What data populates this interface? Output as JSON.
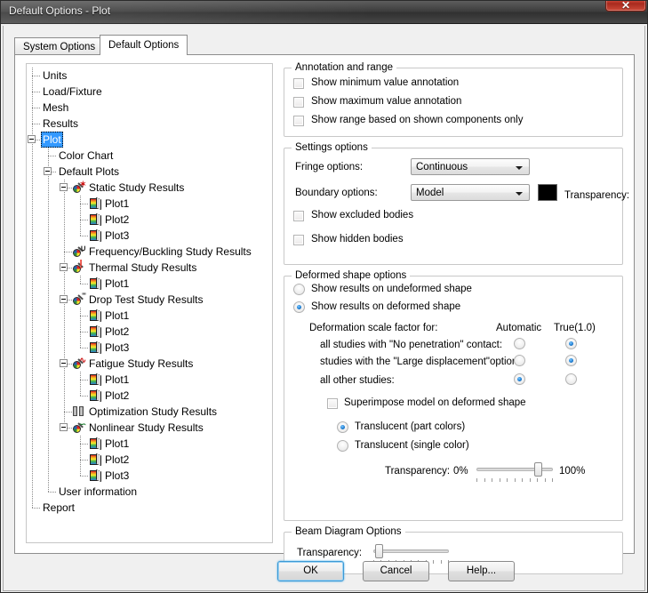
{
  "window": {
    "title": "Default Options - Plot",
    "close_label": "✕"
  },
  "tabs": [
    {
      "label": "System Options",
      "active": false
    },
    {
      "label": "Default Options",
      "active": true
    }
  ],
  "tree": {
    "nodes": [
      {
        "label": "Units",
        "depth": 0,
        "icon": "none",
        "expander": "none",
        "selected": false
      },
      {
        "label": "Load/Fixture",
        "depth": 0,
        "icon": "none",
        "expander": "none",
        "selected": false
      },
      {
        "label": "Mesh",
        "depth": 0,
        "icon": "none",
        "expander": "none",
        "selected": false
      },
      {
        "label": "Results",
        "depth": 0,
        "icon": "none",
        "expander": "none",
        "selected": false
      },
      {
        "label": "Plot",
        "depth": 0,
        "icon": "none",
        "expander": "minus",
        "selected": true
      },
      {
        "label": "Color Chart",
        "depth": 1,
        "icon": "none",
        "expander": "none",
        "selected": false
      },
      {
        "label": "Default Plots",
        "depth": 1,
        "icon": "none",
        "expander": "minus",
        "selected": false
      },
      {
        "label": "Static Study Results",
        "depth": 2,
        "icon": "study-static",
        "expander": "minus",
        "selected": false
      },
      {
        "label": "Plot1",
        "depth": 3,
        "icon": "plot",
        "expander": "none",
        "selected": false
      },
      {
        "label": "Plot2",
        "depth": 3,
        "icon": "plot",
        "expander": "none",
        "selected": false
      },
      {
        "label": "Plot3",
        "depth": 3,
        "icon": "plot",
        "expander": "none",
        "selected": false
      },
      {
        "label": "Frequency/Buckling Study Results",
        "depth": 2,
        "icon": "study-frequency",
        "expander": "none",
        "selected": false
      },
      {
        "label": "Thermal Study Results",
        "depth": 2,
        "icon": "study-thermal",
        "expander": "minus",
        "selected": false
      },
      {
        "label": "Plot1",
        "depth": 3,
        "icon": "plot",
        "expander": "none",
        "selected": false
      },
      {
        "label": "Drop Test Study Results",
        "depth": 2,
        "icon": "study-drop",
        "expander": "minus",
        "selected": false
      },
      {
        "label": "Plot1",
        "depth": 3,
        "icon": "plot",
        "expander": "none",
        "selected": false
      },
      {
        "label": "Plot2",
        "depth": 3,
        "icon": "plot",
        "expander": "none",
        "selected": false
      },
      {
        "label": "Plot3",
        "depth": 3,
        "icon": "plot",
        "expander": "none",
        "selected": false
      },
      {
        "label": "Fatigue Study Results",
        "depth": 2,
        "icon": "study-fatigue",
        "expander": "minus",
        "selected": false
      },
      {
        "label": "Plot1",
        "depth": 3,
        "icon": "plot",
        "expander": "none",
        "selected": false
      },
      {
        "label": "Plot2",
        "depth": 3,
        "icon": "plot",
        "expander": "none",
        "selected": false
      },
      {
        "label": "Optimization Study Results",
        "depth": 2,
        "icon": "study-optimization",
        "expander": "none",
        "selected": false
      },
      {
        "label": "Nonlinear Study Results",
        "depth": 2,
        "icon": "study-nonlinear",
        "expander": "minus",
        "selected": false
      },
      {
        "label": "Plot1",
        "depth": 3,
        "icon": "plot",
        "expander": "none",
        "selected": false
      },
      {
        "label": "Plot2",
        "depth": 3,
        "icon": "plot",
        "expander": "none",
        "selected": false
      },
      {
        "label": "Plot3",
        "depth": 3,
        "icon": "plot",
        "expander": "none",
        "selected": false
      },
      {
        "label": "User information",
        "depth": 1,
        "icon": "none",
        "expander": "none",
        "selected": false
      },
      {
        "label": "Report",
        "depth": 0,
        "icon": "none",
        "expander": "none",
        "selected": false
      }
    ]
  },
  "annotation_group": {
    "caption": "Annotation and range",
    "checkboxes": [
      {
        "label": "Show minimum value annotation",
        "checked": false
      },
      {
        "label": "Show maximum value annotation",
        "checked": false
      },
      {
        "label": "Show range based on shown components only",
        "checked": false
      }
    ]
  },
  "settings_group": {
    "caption": "Settings options",
    "fringe_label": "Fringe options:",
    "fringe_value": "Continuous",
    "boundary_label": "Boundary options:",
    "boundary_value": "Model",
    "boundary_color": "#000000",
    "transparency_label": "Transparency:",
    "checkboxes": [
      {
        "label": "Show excluded bodies",
        "checked": false
      },
      {
        "label": "Show hidden bodies",
        "checked": false
      }
    ]
  },
  "deformed_group": {
    "caption": "Deformed shape options",
    "shape_radios": [
      {
        "label": "Show results on undeformed shape",
        "checked": false
      },
      {
        "label": "Show results on deformed shape",
        "checked": true
      }
    ],
    "scale_label": "Deformation scale factor for:",
    "col_automatic": "Automatic",
    "col_true": "True(1.0)",
    "scale_rows": [
      {
        "label": "all studies with \"No penetration\" contact:",
        "automatic": false,
        "true_scale": true
      },
      {
        "label": "studies with the \"Large displacement\"option:",
        "automatic": false,
        "true_scale": true
      },
      {
        "label": "all other studies:",
        "automatic": true,
        "true_scale": false
      }
    ],
    "superimpose": {
      "label": "Superimpose model on deformed shape",
      "checked": false
    },
    "translucent_radios": [
      {
        "label": "Translucent (part colors)",
        "checked": true
      },
      {
        "label": "Translucent (single color)",
        "checked": false
      }
    ],
    "transparency_label": "Transparency:",
    "transparency_min": "0%",
    "transparency_max": "100%",
    "transparency_value": 85
  },
  "beam_group": {
    "caption": "Beam Diagram Options",
    "transparency_label": "Transparency:",
    "transparency_value": 2
  },
  "buttons": {
    "ok": "OK",
    "cancel": "Cancel",
    "help": "Help..."
  }
}
